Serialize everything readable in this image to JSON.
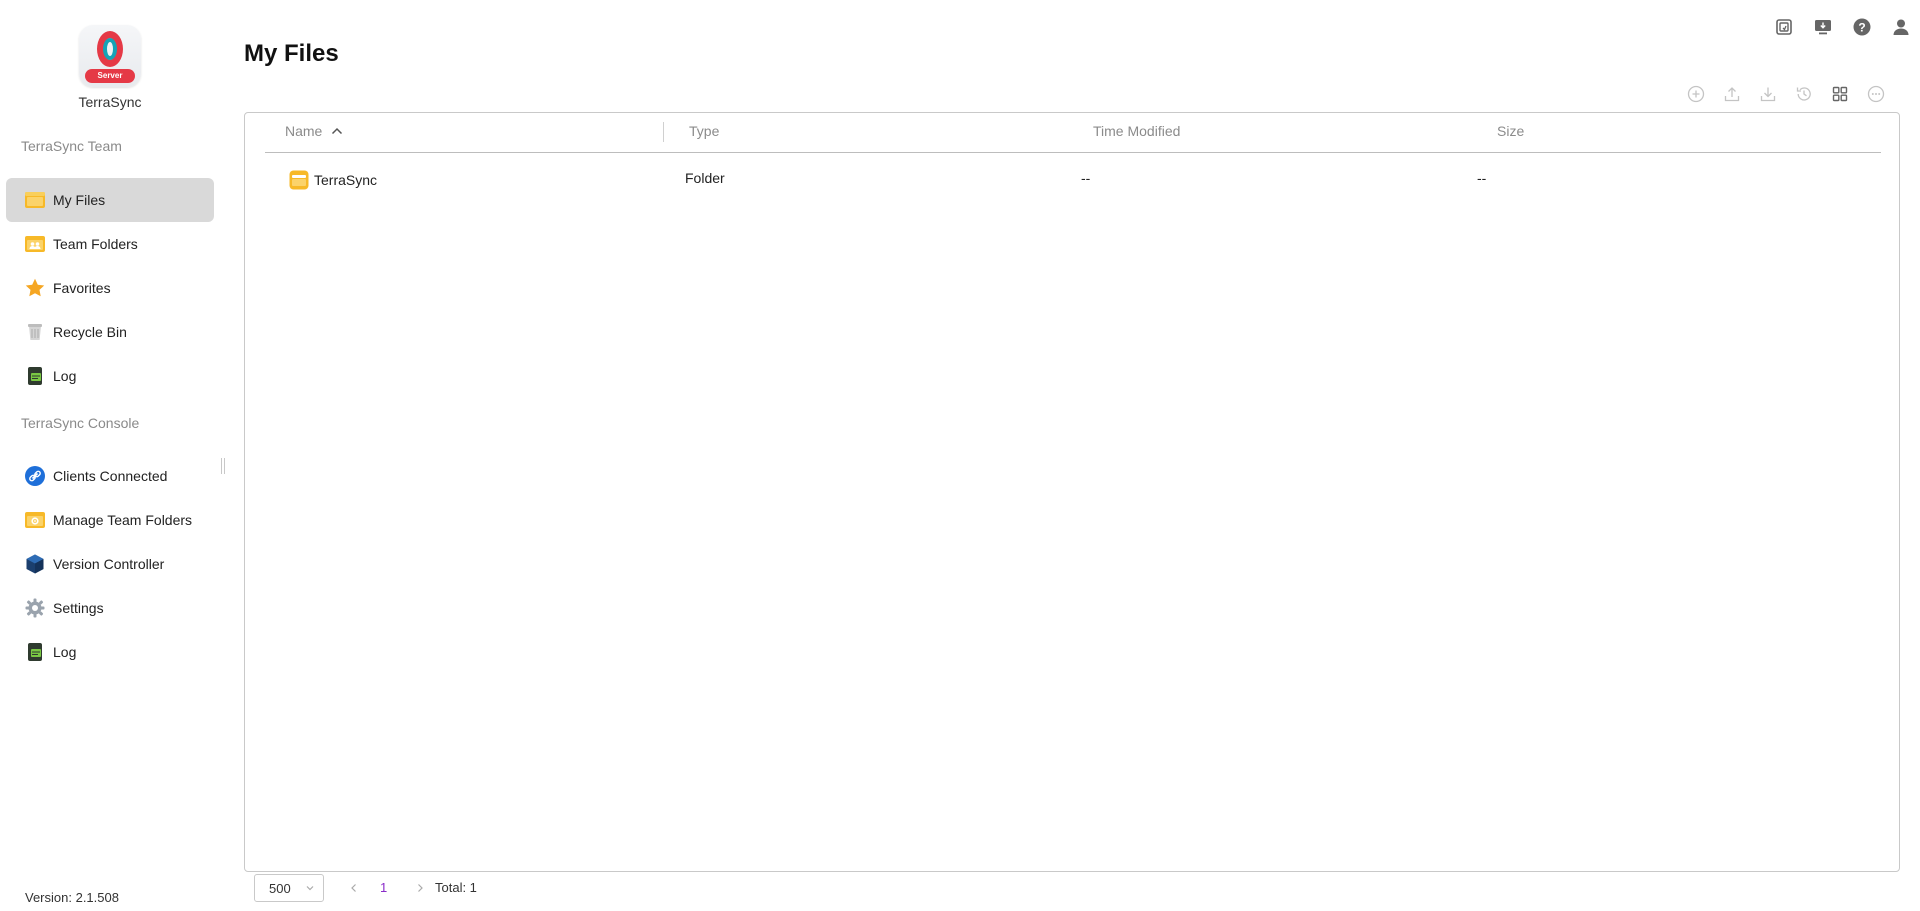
{
  "app": {
    "name": "TerraSync",
    "logo_badge": "Server",
    "version": "Version: 2.1.508"
  },
  "sidebar": {
    "team_section_label": "TerraSync Team",
    "team_items": [
      {
        "label": "My Files",
        "icon": "folder-icon",
        "active": true
      },
      {
        "label": "Team Folders",
        "icon": "team-folder-icon",
        "active": false
      },
      {
        "label": "Favorites",
        "icon": "star-icon",
        "active": false
      },
      {
        "label": "Recycle Bin",
        "icon": "recycle-bin-icon",
        "active": false
      },
      {
        "label": "Log",
        "icon": "log-icon",
        "active": false
      }
    ],
    "console_section_label": "TerraSync Console",
    "console_items": [
      {
        "label": "Clients Connected",
        "icon": "link-icon"
      },
      {
        "label": "Manage Team Folders",
        "icon": "manage-folder-icon"
      },
      {
        "label": "Version Controller",
        "icon": "cube-icon"
      },
      {
        "label": "Settings",
        "icon": "gear-icon"
      },
      {
        "label": "Log",
        "icon": "log-icon"
      }
    ]
  },
  "header": {
    "icons": [
      "background-tasks-icon",
      "remote-desktop-icon",
      "help-icon",
      "user-icon"
    ]
  },
  "main": {
    "title": "My Files",
    "toolbar_icons": [
      "add-icon",
      "upload-icon",
      "download-icon",
      "history-icon",
      "grid-view-icon",
      "more-icon"
    ],
    "columns": {
      "name": "Name",
      "type": "Type",
      "time_modified": "Time Modified",
      "size": "Size"
    },
    "rows": [
      {
        "name": "TerraSync",
        "type": "Folder",
        "time_modified": "--",
        "size": "--",
        "icon": "folder-icon"
      }
    ]
  },
  "pagination": {
    "page_size": "500",
    "current_page": "1",
    "total": "Total: 1"
  },
  "colors": {
    "active_nav_bg": "#d9d9d9",
    "folder_yellow": "#f7b928",
    "page_number_accent": "#8a2cc9",
    "brand_red": "#e53946",
    "brand_teal": "#16a3b6"
  }
}
